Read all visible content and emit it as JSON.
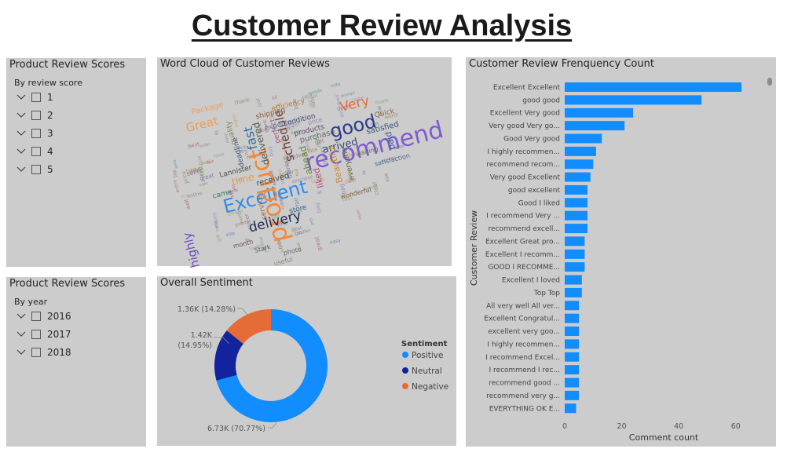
{
  "page": {
    "title": "Customer Review Analysis"
  },
  "score_slicer": {
    "title": "Product Review Scores",
    "subtitle": "By review score",
    "items": [
      "1",
      "2",
      "3",
      "4",
      "5"
    ]
  },
  "year_slicer": {
    "title": "Product Review Scores",
    "subtitle": "By year",
    "items": [
      "2016",
      "2017",
      "2018"
    ]
  },
  "word_cloud": {
    "title": "Word Cloud of Customer Reviews",
    "words": [
      {
        "text": "Excellent",
        "color": "#2e8ef0"
      },
      {
        "text": "recommend",
        "color": "#7f5ad4"
      },
      {
        "text": "product",
        "color": "#f28a3c"
      },
      {
        "text": "good",
        "color": "#2b3a8c"
      },
      {
        "text": "delivery",
        "color": "#1f2a5a"
      },
      {
        "text": "highly",
        "color": "#6a4cc2"
      },
      {
        "text": "Very",
        "color": "#e56c3a"
      },
      {
        "text": "fast",
        "color": "#2e6a9e"
      },
      {
        "text": "Great",
        "color": "#f09a50"
      },
      {
        "text": "arrived",
        "color": "#3a4a7a"
      },
      {
        "text": "time",
        "color": "#e8a050"
      },
      {
        "text": "schedule",
        "color": "#6a3a3a"
      },
      {
        "text": "delivered",
        "color": "#5a5a5a"
      },
      {
        "text": "ahead",
        "color": "#6a8a3a"
      },
      {
        "text": "satisfied",
        "color": "#3a5a7a"
      },
      {
        "text": "received",
        "color": "#4a4a4a"
      },
      {
        "text": "store",
        "color": "#3a6a9a"
      },
      {
        "text": "liked",
        "color": "#b04a7a"
      },
      {
        "text": "purchase",
        "color": "#6a6a6a"
      },
      {
        "text": "Beautiful",
        "color": "#d08a3a"
      },
      {
        "text": "Package",
        "color": "#f0a060"
      },
      {
        "text": "condition",
        "color": "#4a4a6a"
      },
      {
        "text": "quality",
        "color": "#7a8a4a"
      },
      {
        "text": "perfect",
        "color": "#a05a8a"
      },
      {
        "text": "everyone",
        "color": "#5a6a3a"
      },
      {
        "text": "deadline",
        "color": "#4a5a7a"
      },
      {
        "text": "shipping",
        "color": "#8a5a3a"
      },
      {
        "text": "products",
        "color": "#5a4a6a"
      },
      {
        "text": "came",
        "color": "#3a7a6a"
      },
      {
        "text": "Lannister",
        "color": "#4a4a4a"
      },
      {
        "text": "service",
        "color": "#9a6a4a"
      },
      {
        "text": "expected",
        "color": "#6a7a9a"
      },
      {
        "text": "wonderful",
        "color": "#7a5a3a"
      },
      {
        "text": "waiting",
        "color": "#5a7a4a"
      },
      {
        "text": "photo",
        "color": "#6a6a6a"
      },
      {
        "text": "satisfaction",
        "color": "#4a6a8a"
      },
      {
        "text": "month",
        "color": "#7a4a5a"
      },
      {
        "text": "paid",
        "color": "#3a5a8a"
      },
      {
        "text": "Quick",
        "color": "#8a6a3a"
      },
      {
        "text": "Stark",
        "color": "#5a5a5a"
      },
      {
        "text": "useful",
        "color": "#8a8a6a"
      },
      {
        "text": "efficiency",
        "color": "#c07a3a"
      }
    ]
  },
  "sentiment": {
    "title": "Overall Sentiment",
    "legend_title": "Sentiment",
    "labels": {
      "positive": "6.73K (70.77%)",
      "neutral_value": "1.42K",
      "neutral_pct": "(14.95%)",
      "negative": "1.36K (14.28%)"
    }
  },
  "frequency": {
    "title": "Customer Review Frenquency Count",
    "scroll_position": 0
  },
  "chart_data": [
    {
      "type": "pie",
      "title": "Overall Sentiment",
      "legend_title": "Sentiment",
      "legend_position": "right",
      "series": [
        {
          "name": "Positive",
          "value": 6730,
          "percent": 70.77,
          "color": "#118dff"
        },
        {
          "name": "Neutral",
          "value": 1420,
          "percent": 14.95,
          "color": "#12239e"
        },
        {
          "name": "Negative",
          "value": 1360,
          "percent": 14.28,
          "color": "#e66c37"
        }
      ]
    },
    {
      "type": "bar",
      "orientation": "horizontal",
      "title": "Customer Review Frenquency Count",
      "xlabel": "Comment count",
      "ylabel": "Customer Review",
      "xlim": [
        0,
        70
      ],
      "xticks": [
        0,
        20,
        40,
        60
      ],
      "grid": false,
      "color": "#118dff",
      "categories": [
        "Excellent Excellent",
        "good good",
        "Excellent Very good",
        "Very good Very go...",
        "Good Very good",
        "I highly recommen...",
        "recommend recom...",
        "Very good Excellent",
        "good excellent",
        "Good I liked",
        "I recommend Very ...",
        "recommend excell...",
        "Excellent Great pro...",
        "Excellent I recomm...",
        "GOOD I RECOMME...",
        "Excellent I loved",
        "Top Top",
        "All very well All ver...",
        "Excellent Congratul...",
        "excellent very goo...",
        "I highly recommen...",
        "I recommend Excel...",
        "I recommend I rec...",
        "recommend good ...",
        "recommend very g...",
        "EVERYTHING OK E..."
      ],
      "values": [
        62,
        48,
        24,
        21,
        13,
        11,
        10,
        9,
        8,
        8,
        8,
        8,
        7,
        7,
        7,
        6,
        6,
        5,
        5,
        5,
        5,
        5,
        5,
        5,
        5,
        4
      ]
    }
  ]
}
